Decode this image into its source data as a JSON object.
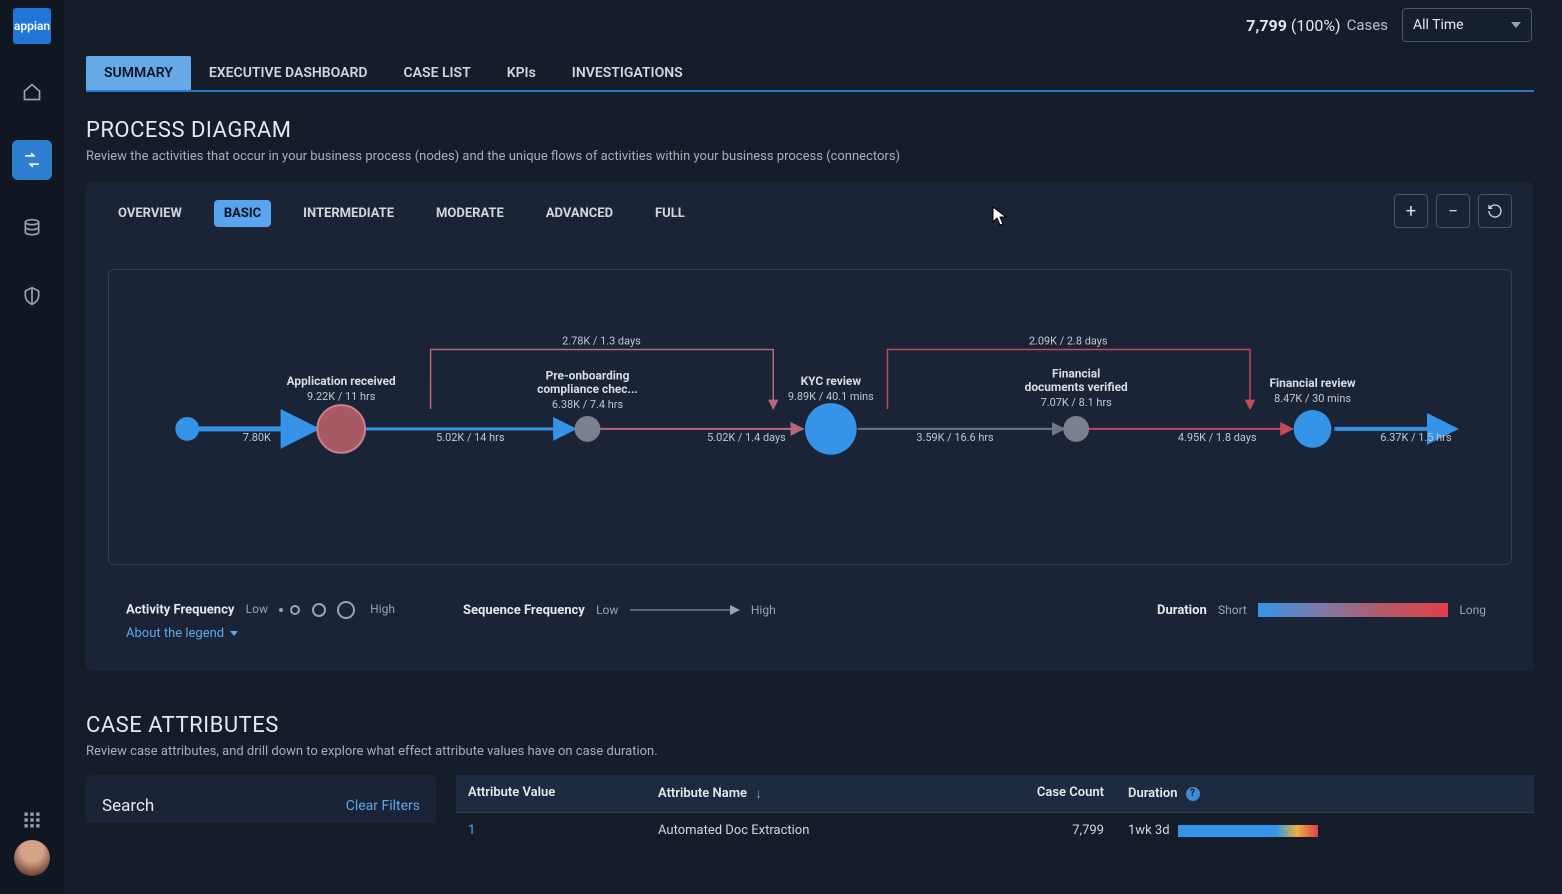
{
  "logo_text": "appian",
  "header": {
    "count": "7,799",
    "percent": "(100%)",
    "label": "Cases",
    "select_value": "All Time"
  },
  "tabs": [
    "SUMMARY",
    "EXECUTIVE DASHBOARD",
    "CASE LIST",
    "KPIs",
    "INVESTIGATIONS"
  ],
  "section": {
    "title": "PROCESS DIAGRAM",
    "desc": "Review the activities that occur in your business process (nodes) and the unique flows of activities within your business process (connectors)"
  },
  "detail_tabs": [
    "OVERVIEW",
    "BASIC",
    "INTERMEDIATE",
    "MODERATE",
    "ADVANCED",
    "FULL"
  ],
  "nodes": {
    "n1": {
      "label_line1": "Application received",
      "sub": "9.22K / 11 hrs"
    },
    "n2": {
      "label_line1": "Pre-onboarding",
      "label_line2": "compliance chec...",
      "sub": "6.38K / 7.4 hrs"
    },
    "n3": {
      "label_line1": "KYC review",
      "sub": "9.89K / 40.1 mins"
    },
    "n4": {
      "label_line1": "Financial",
      "label_line2": "documents verified",
      "sub": "7.07K / 8.1 hrs"
    },
    "n5": {
      "label_line1": "Financial review",
      "sub": "8.47K / 30 mins"
    }
  },
  "edges": {
    "e0_1": "7.80K",
    "e1_2": "5.02K / 14 hrs",
    "e2_3": "5.02K / 1.4 days",
    "e3_4": "3.59K / 16.6 hrs",
    "e4_5": "4.95K / 1.8 days",
    "e5_out": "6.37K / 1.5 hrs",
    "e1_3_top": "2.78K / 1.3 days",
    "e3_5_top": "2.09K / 2.8 days"
  },
  "legend": {
    "freq_title": "Activity Frequency",
    "freq_low": "Low",
    "freq_high": "High",
    "seq_title": "Sequence Frequency",
    "seq_low": "Low",
    "seq_high": "High",
    "dur_title": "Duration",
    "dur_short": "Short",
    "dur_long": "Long",
    "about_link": "About the legend"
  },
  "ca": {
    "title": "CASE ATTRIBUTES",
    "desc": "Review case attributes, and drill down to explore what effect attribute values have on case duration.",
    "search_title": "Search",
    "clear": "Clear Filters",
    "cols": {
      "a": "Attribute Value",
      "b": "Attribute Name",
      "c": "Case Count",
      "d": "Duration"
    },
    "row1": {
      "a": "1",
      "b": "Automated Doc Extraction",
      "c": "7,799",
      "d": "1wk 3d"
    }
  }
}
